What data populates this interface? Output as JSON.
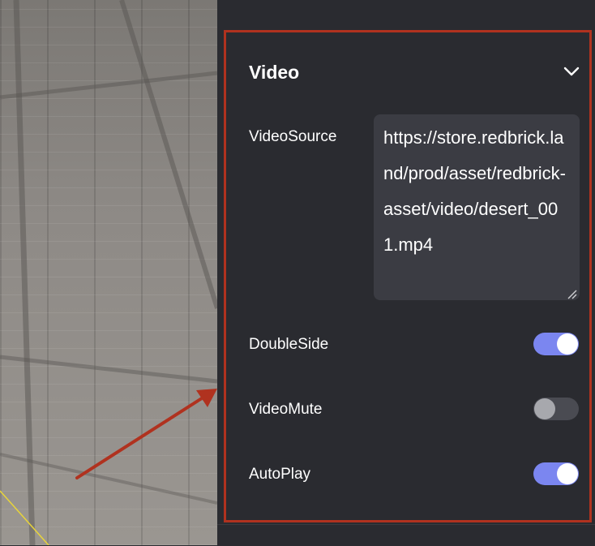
{
  "panel": {
    "section_title": "Video",
    "fields": {
      "video_source": {
        "label": "VideoSource",
        "value": "https://store.redbrick.land/prod/asset/redbrick-asset/video/desert_001.mp4"
      },
      "double_side": {
        "label": "DoubleSide",
        "enabled": true
      },
      "video_mute": {
        "label": "VideoMute",
        "enabled": false
      },
      "auto_play": {
        "label": "AutoPlay",
        "enabled": true
      }
    }
  },
  "colors": {
    "panel_bg": "#2a2b30",
    "highlight_border": "#b0321f",
    "toggle_on": "#7b86f0",
    "toggle_off": "#4a4b52",
    "input_bg": "#3b3c43"
  },
  "icons": {
    "collapse": "chevron-down-icon",
    "annotation": "arrow-icon",
    "resize": "resize-grip-icon"
  }
}
